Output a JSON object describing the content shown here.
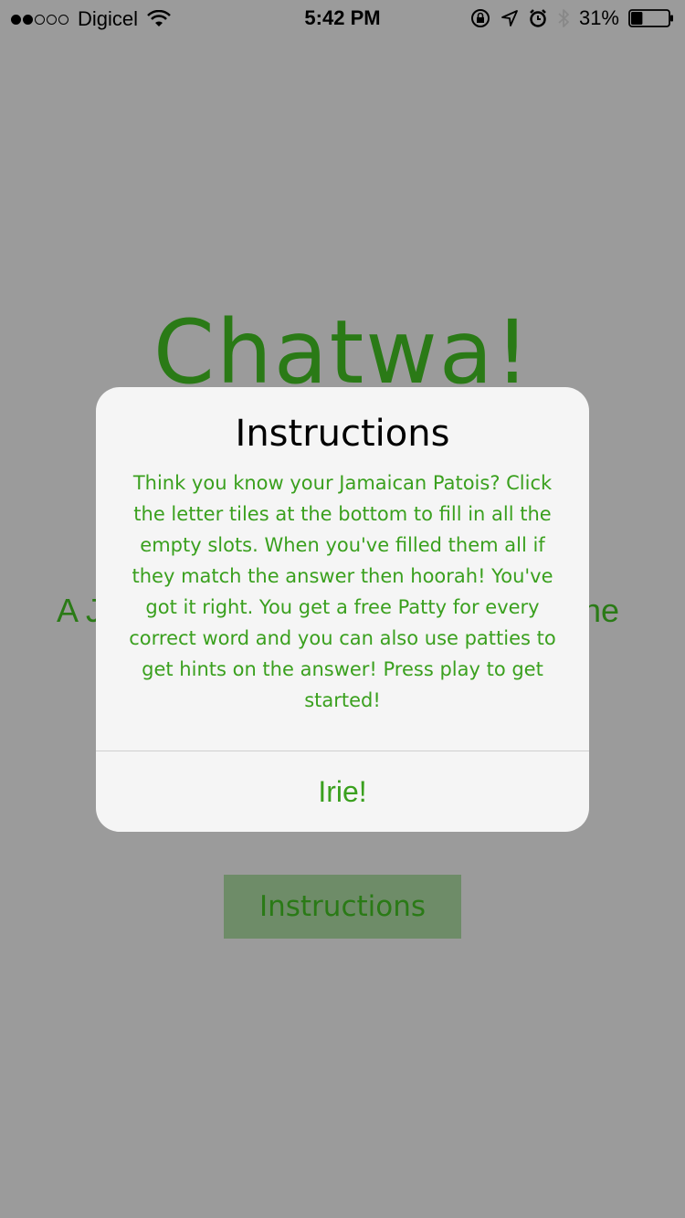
{
  "status_bar": {
    "carrier": "Digicel",
    "time": "5:42 PM",
    "battery_percent": "31%",
    "battery_level": 0.31
  },
  "background": {
    "app_title": "Chatwa!",
    "tagline_left": "A J",
    "tagline_right": "ne",
    "instructions_button_label": "Instructions"
  },
  "alert": {
    "title": "Instructions",
    "message": "Think you know your Jamaican Patois? Click the letter tiles at the bottom to fill in all the empty slots. When you've filled them all if they match the answer then hoorah! You've got it right. You get a free Patty for every correct word and you can also use patties to get hints on the answer! Press play to get started!",
    "button_label": "Irie!"
  },
  "colors": {
    "overlay": "#9b9b9b",
    "brand_green": "#2a7a16",
    "text_green": "#3aa01e"
  }
}
